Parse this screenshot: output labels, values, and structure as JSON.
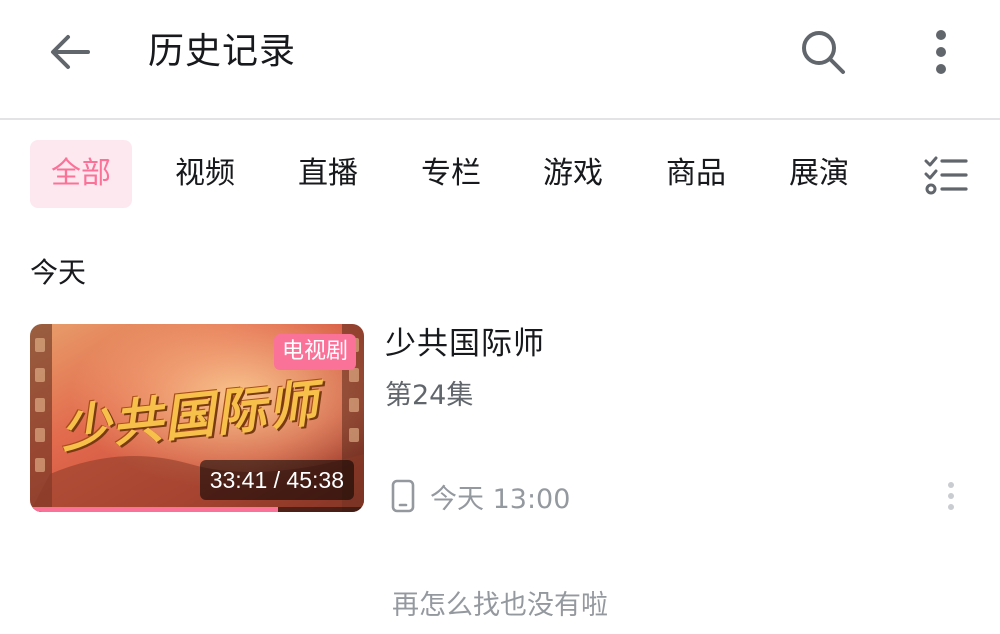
{
  "header": {
    "title": "历史记录"
  },
  "tabs": [
    {
      "label": "全部",
      "active": true
    },
    {
      "label": "视频",
      "active": false
    },
    {
      "label": "直播",
      "active": false
    },
    {
      "label": "专栏",
      "active": false
    },
    {
      "label": "游戏",
      "active": false
    },
    {
      "label": "商品",
      "active": false
    },
    {
      "label": "展演",
      "active": false
    }
  ],
  "section": {
    "label": "今天"
  },
  "items": [
    {
      "title": "少共国际师",
      "episode": "第24集",
      "badge": "电视剧",
      "duration": "33:41 / 45:38",
      "progress_fraction": 0.742,
      "device_icon": "phone-icon",
      "time": "今天 13:00",
      "thumbnail_text": "少共国际师"
    }
  ],
  "footer": {
    "end_text": "再怎么找也没有啦"
  },
  "colors": {
    "accent": "#fb7299",
    "accent_bg": "#fde8ef",
    "text_primary": "#18191c",
    "text_secondary": "#61666d",
    "text_muted": "#9499a0"
  }
}
